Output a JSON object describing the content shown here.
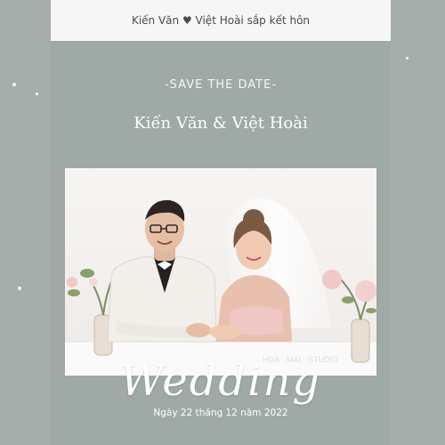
{
  "header": {
    "title": "Kiến Văn ♥ Việt Hoài sắp kết hôn"
  },
  "invite": {
    "save_the_date": "-SAVE THE DATE-",
    "couple_names": "Kiến Văn  &  Việt Hoài",
    "wedding": "Wedding",
    "date": "Ngày 22 tháng 12 năm 2022"
  },
  "colors": {
    "page_bg": "#a6aeac",
    "card_bg": "#9fa9a6",
    "header_bg": "#f6f6f6"
  }
}
